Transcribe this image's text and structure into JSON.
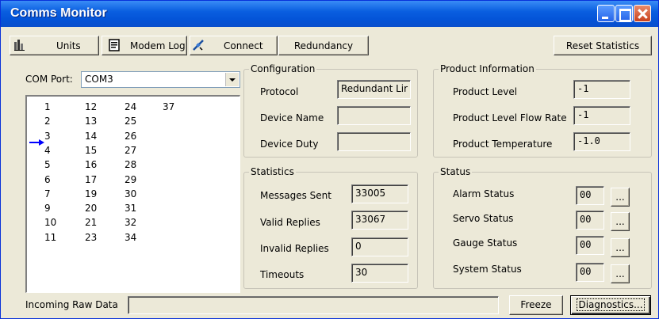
{
  "window": {
    "title": "Comms Monitor"
  },
  "toolbar": {
    "units": {
      "label": "Units",
      "icon": "units-icon"
    },
    "modem_log": {
      "label": "Modem Log",
      "icon": "modem-log-icon"
    },
    "connect": {
      "label": "Connect",
      "icon": "connect-icon"
    },
    "redundancy": {
      "label": "Redundancy"
    },
    "reset": {
      "label": "Reset Statistics"
    }
  },
  "com_port": {
    "label": "COM Port:",
    "value": "COM3"
  },
  "device_list": {
    "col1": [
      "1",
      "2",
      "3",
      "4",
      "5",
      "6",
      "7",
      "9",
      "10",
      "11"
    ],
    "col2": [
      "12",
      "13",
      "14",
      "15",
      "16",
      "17",
      "19",
      "20",
      "21",
      "23"
    ],
    "col3": [
      "24",
      "25",
      "26",
      "27",
      "28",
      "29",
      "30",
      "31",
      "32",
      "34"
    ],
    "col4": [
      "37"
    ],
    "current_marker_color": "#0000ff"
  },
  "configuration": {
    "title": "Configuration",
    "protocol_label": "Protocol",
    "protocol_value": "Redundant Lir",
    "device_name_label": "Device Name",
    "device_name_value": "",
    "device_duty_label": "Device Duty",
    "device_duty_value": ""
  },
  "product_info": {
    "title": "Product Information",
    "level_label": "Product Level",
    "level_value": "-1",
    "flow_label": "Product Level Flow Rate",
    "flow_value": "-1",
    "temp_label": "Product Temperature",
    "temp_value": "-1.0"
  },
  "statistics": {
    "title": "Statistics",
    "sent_label": "Messages Sent",
    "sent_value": "33005",
    "valid_label": "Valid Replies",
    "valid_value": "33067",
    "invalid_label": "Invalid Replies",
    "invalid_value": "0",
    "timeouts_label": "Timeouts",
    "timeouts_value": "30"
  },
  "status": {
    "title": "Status",
    "dots_label": "...",
    "items": [
      {
        "label": "Alarm Status",
        "value": "00"
      },
      {
        "label": "Servo Status",
        "value": "00"
      },
      {
        "label": "Gauge Status",
        "value": "00"
      },
      {
        "label": "System Status",
        "value": "00"
      }
    ]
  },
  "footer": {
    "raw_label": "Incoming Raw Data",
    "raw_value": "",
    "freeze_label": "Freeze",
    "diagnostics_label": "Diagnostics..."
  },
  "colors": {
    "titlebar": "#0454d8",
    "panel": "#ece9d8"
  }
}
